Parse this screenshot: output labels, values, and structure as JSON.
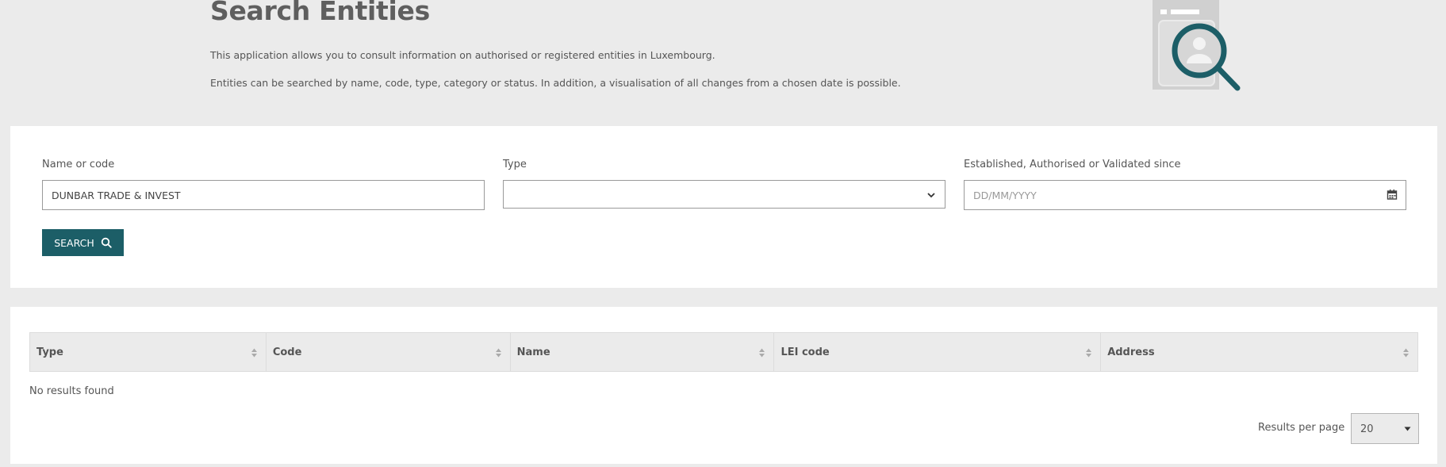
{
  "header": {
    "title": "Search Entities",
    "intro_1": "This application allows you to consult information on authorised or registered entities in Luxembourg.",
    "intro_2": "Entities can be searched by name, code, type, category or status. In addition, a visualisation of all changes from a chosen date is possible.",
    "illustration_icon": "document-magnifier-icon"
  },
  "search_form": {
    "name_label": "Name or code",
    "name_value": "DUNBAR TRADE & INVEST",
    "type_label": "Type",
    "type_value": "",
    "date_label": "Established, Authorised or Validated since",
    "date_placeholder": "DD/MM/YYYY",
    "search_button": "SEARCH"
  },
  "results": {
    "columns": [
      "Type",
      "Code",
      "Name",
      "LEI code",
      "Address"
    ],
    "empty_message": "No results found",
    "per_page_label": "Results per page",
    "per_page_value": "20"
  },
  "colors": {
    "accent": "#1c5e67",
    "background": "#ebebeb",
    "panel": "#ffffff"
  }
}
